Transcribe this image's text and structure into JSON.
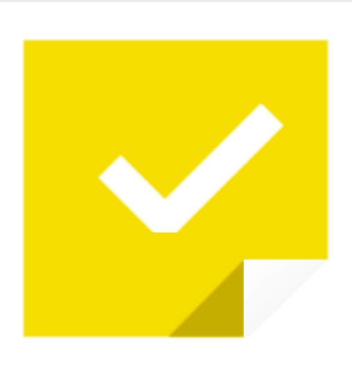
{
  "icon": {
    "name": "sticky-note-checkmark-icon",
    "colors": {
      "note": "#f5dd00",
      "note_edge": "#f0d700",
      "fold_shadow": "#c6ae00",
      "fold_paper": "#ffffff",
      "check": "#ffffff",
      "background": "#ffffff"
    }
  }
}
